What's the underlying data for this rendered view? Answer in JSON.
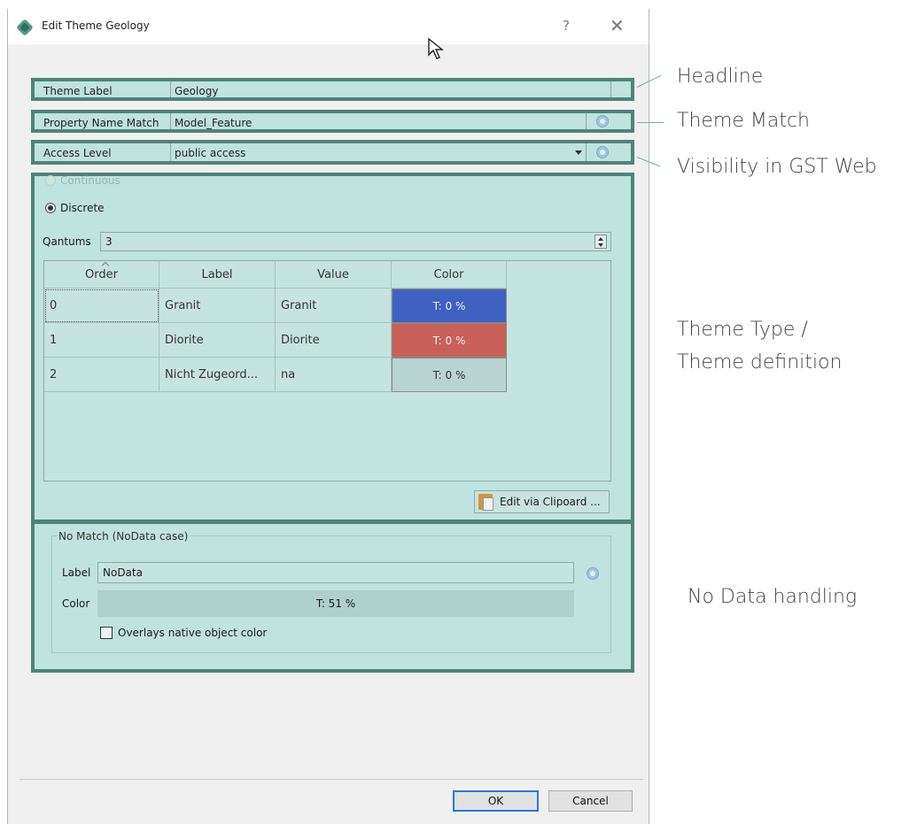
{
  "window": {
    "title": "Edit Theme Geology",
    "help_glyph": "?",
    "close_glyph": "✕"
  },
  "headline": {
    "label": "Theme Label",
    "value": "Geology"
  },
  "match": {
    "label": "Property Name Match",
    "value": "Model_Feature"
  },
  "access": {
    "label": "Access Level",
    "value": "public access"
  },
  "theme_type": {
    "continuous_label": "Continuous",
    "discrete_label": "Discrete",
    "quantums_label": "Qantums",
    "quantums_value": "3",
    "columns": [
      "Order",
      "Label",
      "Value",
      "Color"
    ],
    "rows": [
      {
        "order": "0",
        "label": "Granit",
        "value": "Granit",
        "color_text": "T: 0 %",
        "color": "#3f62c2"
      },
      {
        "order": "1",
        "label": "Diorite",
        "value": "Diorite",
        "color_text": "T: 0 %",
        "color": "#c9605a"
      },
      {
        "order": "2",
        "label": "Nicht Zugeord...",
        "value": "na",
        "color_text": "T: 0 %",
        "color": "#b8d5d1"
      }
    ],
    "edit_clipboard_label": "Edit via Clipoard ..."
  },
  "nodata": {
    "group_title": "No Match (NoData case)",
    "label_caption": "Label",
    "label_value": "NoData",
    "color_caption": "Color",
    "color_text": "T: 51 %",
    "overlay_label": "Overlays native object color"
  },
  "buttons": {
    "ok": "OK",
    "cancel": "Cancel"
  },
  "annotations": {
    "headline": "Headline",
    "theme_match": "Theme Match",
    "visibility": "Visibility in GST Web",
    "theme_type_line1": "Theme Type /",
    "theme_type_line2": "Theme definition",
    "no_data": "No Data handling"
  },
  "colors": {
    "highlight_border": "#4e8478",
    "highlight_fill": "#bfe3de",
    "accent_blue": "#2b78d6"
  }
}
